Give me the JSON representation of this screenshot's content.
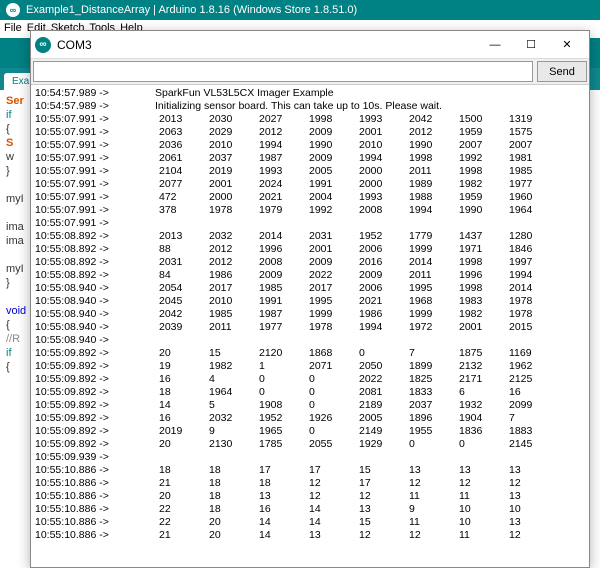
{
  "ide": {
    "title": "Example1_DistanceArray | Arduino 1.8.16 (Windows Store 1.8.51.0)",
    "menu": [
      "File",
      "Edit",
      "Sketch",
      "Tools",
      "Help"
    ],
    "tab": "Exa",
    "code_tokens": [
      {
        "t": "Ser",
        "c": "kw-orange"
      },
      {
        "t": "if",
        "c": "kw-teal"
      },
      {
        "t": "{",
        "c": ""
      },
      {
        "t": "S",
        "c": "kw-orange"
      },
      {
        "t": "w",
        "c": ""
      },
      {
        "t": "}",
        "c": ""
      },
      {
        "t": "",
        "c": ""
      },
      {
        "t": "myI",
        "c": ""
      },
      {
        "t": "",
        "c": ""
      },
      {
        "t": "ima",
        "c": ""
      },
      {
        "t": "ima",
        "c": ""
      },
      {
        "t": "",
        "c": ""
      },
      {
        "t": "myI",
        "c": ""
      },
      {
        "t": "}",
        "c": ""
      },
      {
        "t": "",
        "c": ""
      },
      {
        "t": "void",
        "c": "kw-blue"
      },
      {
        "t": "{",
        "c": ""
      },
      {
        "t": "//R",
        "c": "kw-gray"
      },
      {
        "t": "if",
        "c": "kw-teal"
      },
      {
        "t": "{",
        "c": ""
      }
    ]
  },
  "serial": {
    "port": "COM3",
    "send_label": "Send",
    "input_value": "",
    "intro": [
      {
        "ts": "10:54:57.989 ->",
        "msg": "SparkFun VL53L5CX Imager Example"
      },
      {
        "ts": "10:54:57.989 ->",
        "msg": "Initializing sensor board. This can take up to 10s. Please wait."
      }
    ],
    "rows": [
      {
        "ts": "10:55:07.991 ->",
        "v": [
          "2013",
          "2030",
          "2027",
          "1998",
          "1993",
          "2042",
          "1500",
          "1319"
        ]
      },
      {
        "ts": "10:55:07.991 ->",
        "v": [
          "2063",
          "2029",
          "2012",
          "2009",
          "2001",
          "2012",
          "1959",
          "1575"
        ]
      },
      {
        "ts": "10:55:07.991 ->",
        "v": [
          "2036",
          "2010",
          "1994",
          "1990",
          "2010",
          "1990",
          "2007",
          "2007"
        ]
      },
      {
        "ts": "10:55:07.991 ->",
        "v": [
          "2061",
          "2037",
          "1987",
          "2009",
          "1994",
          "1998",
          "1992",
          "1981"
        ]
      },
      {
        "ts": "10:55:07.991 ->",
        "v": [
          "2104",
          "2019",
          "1993",
          "2005",
          "2000",
          "2011",
          "1998",
          "1985"
        ]
      },
      {
        "ts": "10:55:07.991 ->",
        "v": [
          "2077",
          "2001",
          "2024",
          "1991",
          "2000",
          "1989",
          "1982",
          "1977"
        ]
      },
      {
        "ts": "10:55:07.991 ->",
        "v": [
          "472",
          "2000",
          "2021",
          "2004",
          "1993",
          "1988",
          "1959",
          "1960"
        ]
      },
      {
        "ts": "10:55:07.991 ->",
        "v": [
          "378",
          "1978",
          "1979",
          "1992",
          "2008",
          "1994",
          "1990",
          "1964"
        ]
      },
      {
        "ts": "10:55:07.991 ->",
        "v": []
      },
      {
        "ts": "10:55:08.892 ->",
        "v": [
          "2013",
          "2032",
          "2014",
          "2031",
          "1952",
          "1779",
          "1437",
          "1280"
        ]
      },
      {
        "ts": "10:55:08.892 ->",
        "v": [
          "88",
          "2012",
          "1996",
          "2001",
          "2006",
          "1999",
          "1971",
          "1846"
        ]
      },
      {
        "ts": "10:55:08.892 ->",
        "v": [
          "2031",
          "2012",
          "2008",
          "2009",
          "2016",
          "2014",
          "1998",
          "1997"
        ]
      },
      {
        "ts": "10:55:08.892 ->",
        "v": [
          "84",
          "1986",
          "2009",
          "2022",
          "2009",
          "2011",
          "1996",
          "1994"
        ]
      },
      {
        "ts": "10:55:08.940 ->",
        "v": [
          "2054",
          "2017",
          "1985",
          "2017",
          "2006",
          "1995",
          "1998",
          "2014"
        ]
      },
      {
        "ts": "10:55:08.940 ->",
        "v": [
          "2045",
          "2010",
          "1991",
          "1995",
          "2021",
          "1968",
          "1983",
          "1978"
        ]
      },
      {
        "ts": "10:55:08.940 ->",
        "v": [
          "2042",
          "1985",
          "1987",
          "1999",
          "1986",
          "1999",
          "1982",
          "1978"
        ]
      },
      {
        "ts": "10:55:08.940 ->",
        "v": [
          "2039",
          "2011",
          "1977",
          "1978",
          "1994",
          "1972",
          "2001",
          "2015"
        ]
      },
      {
        "ts": "10:55:08.940 ->",
        "v": []
      },
      {
        "ts": "10:55:09.892 ->",
        "v": [
          "20",
          "15",
          "2120",
          "1868",
          "0",
          "7",
          "1875",
          "1169"
        ]
      },
      {
        "ts": "10:55:09.892 ->",
        "v": [
          "19",
          "1982",
          "1",
          "2071",
          "2050",
          "1899",
          "2132",
          "1962"
        ]
      },
      {
        "ts": "10:55:09.892 ->",
        "v": [
          "16",
          "4",
          "0",
          "0",
          "2022",
          "1825",
          "2171",
          "2125"
        ]
      },
      {
        "ts": "10:55:09.892 ->",
        "v": [
          "18",
          "1964",
          "0",
          "0",
          "2081",
          "1833",
          "6",
          "16"
        ]
      },
      {
        "ts": "10:55:09.892 ->",
        "v": [
          "14",
          "5",
          "1908",
          "0",
          "2189",
          "2037",
          "1932",
          "2099"
        ]
      },
      {
        "ts": "10:55:09.892 ->",
        "v": [
          "16",
          "2032",
          "1952",
          "1926",
          "2005",
          "1896",
          "1904",
          "7"
        ]
      },
      {
        "ts": "10:55:09.892 ->",
        "v": [
          "2019",
          "9",
          "1965",
          "0",
          "2149",
          "1955",
          "1836",
          "1883"
        ]
      },
      {
        "ts": "10:55:09.892 ->",
        "v": [
          "20",
          "2130",
          "1785",
          "2055",
          "1929",
          "0",
          "0",
          "2145"
        ]
      },
      {
        "ts": "10:55:09.939 ->",
        "v": []
      },
      {
        "ts": "10:55:10.886 ->",
        "v": [
          "18",
          "18",
          "17",
          "17",
          "15",
          "13",
          "13",
          "13"
        ]
      },
      {
        "ts": "10:55:10.886 ->",
        "v": [
          "21",
          "18",
          "18",
          "12",
          "17",
          "12",
          "12",
          "12"
        ]
      },
      {
        "ts": "10:55:10.886 ->",
        "v": [
          "20",
          "18",
          "13",
          "12",
          "12",
          "11",
          "11",
          "13"
        ]
      },
      {
        "ts": "10:55:10.886 ->",
        "v": [
          "22",
          "18",
          "16",
          "14",
          "13",
          "9",
          "10",
          "10"
        ]
      },
      {
        "ts": "10:55:10.886 ->",
        "v": [
          "22",
          "20",
          "14",
          "14",
          "15",
          "11",
          "10",
          "13"
        ]
      },
      {
        "ts": "10:55:10.886 ->",
        "v": [
          "21",
          "20",
          "14",
          "13",
          "12",
          "12",
          "11",
          "12"
        ]
      }
    ]
  }
}
